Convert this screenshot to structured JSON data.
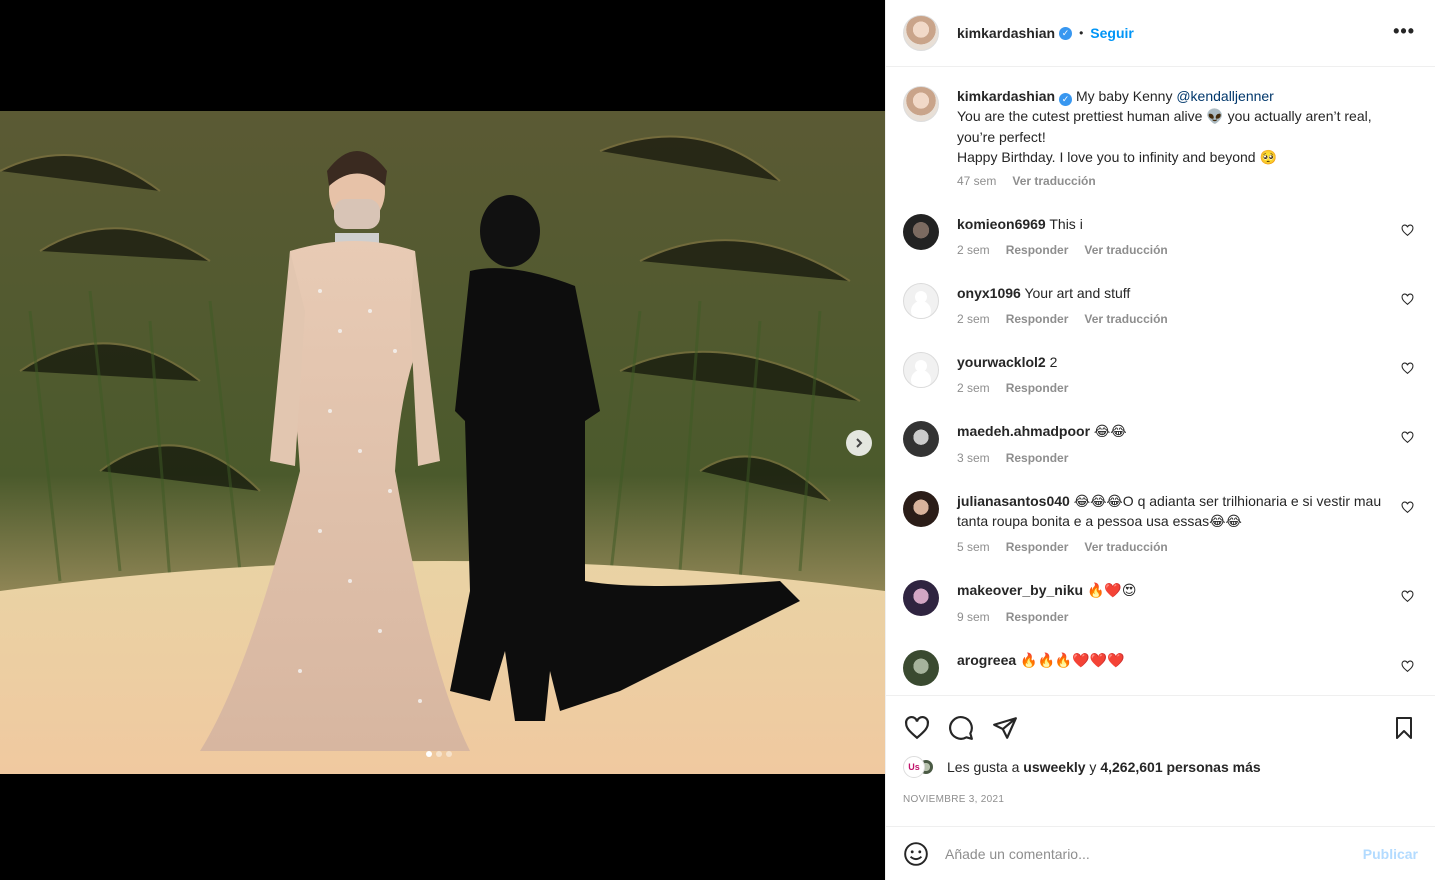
{
  "post": {
    "author": "kimkardashian",
    "follow_label": "Seguir",
    "separator": "•",
    "more_label": "•••"
  },
  "caption": {
    "username": "kimkardashian",
    "text_pre": "My baby Kenny ",
    "mention": "@kendalljenner",
    "line2_a": "You are the cutest prettiest human alive ",
    "line2_emoji": "👽",
    "line2_b": " you actually aren’t real, you’re perfect!",
    "line3": "Happy Birthday. I love you to infinity and beyond ",
    "line3_emoji": "🥺",
    "time": "47 sem",
    "translate": "Ver traducción"
  },
  "comments": [
    {
      "username": "komieon6969",
      "text": "This i",
      "time": "2 sem",
      "reply": "Responder",
      "translate": "Ver traducción"
    },
    {
      "username": "onyx1096",
      "text": "Your art and stuff",
      "time": "2 sem",
      "reply": "Responder",
      "translate": "Ver traducción"
    },
    {
      "username": "yourwacklol2",
      "text": "2",
      "time": "2 sem",
      "reply": "Responder"
    },
    {
      "username": "maedeh.ahmadpoor",
      "text": "😂😂",
      "time": "3 sem",
      "reply": "Responder"
    },
    {
      "username": "julianasantos040",
      "text": "😂😂😂O q adianta ser trilhionaria e si vestir mau tanta roupa bonita e a pessoa usa essas😂😂",
      "time": "5 sem",
      "reply": "Responder",
      "translate": "Ver traducción"
    },
    {
      "username": "makeover_by_niku",
      "text": "🔥❤️😍",
      "time": "9 sem",
      "reply": "Responder"
    },
    {
      "username": "arogreea",
      "text": "🔥🔥🔥❤️❤️❤️",
      "time": "",
      "reply": ""
    }
  ],
  "likes": {
    "badge": "Us",
    "prefix": "Les gusta a ",
    "user": "usweekly",
    "middle": " y ",
    "count": "4,262,601 personas más"
  },
  "date": "NOVIEMBRE 3, 2021",
  "add_comment": {
    "placeholder": "Añade un comentario...",
    "publish": "Publicar"
  },
  "colors": {
    "link_blue": "#0095f6",
    "publish_disabled": "#b3dbff",
    "muted": "#8e8e8e"
  }
}
